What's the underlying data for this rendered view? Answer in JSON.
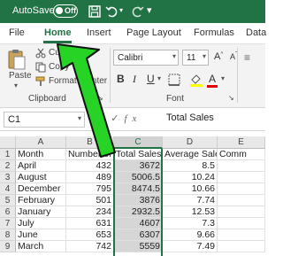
{
  "titlebar": {
    "autosave_label": "AutoSave",
    "autosave_state": "Off",
    "colors": {
      "bar": "#217346",
      "text": "#ffffff"
    },
    "icons": [
      "save-icon",
      "undo-icon",
      "redo-icon",
      "more-icon"
    ]
  },
  "tabs": [
    {
      "label": "File"
    },
    {
      "label": "Home",
      "active": true
    },
    {
      "label": "Insert"
    },
    {
      "label": "Page Layout"
    },
    {
      "label": "Formulas"
    },
    {
      "label": "Data"
    }
  ],
  "ribbon": {
    "paste_label": "Paste",
    "cut_label": "Cut",
    "copy_label": "Copy",
    "format_painter_label": "Format Painter",
    "clipboard_group": "Clipboard",
    "font_name": "Calibri",
    "font_size": "11",
    "font_group": "Font",
    "bold": "B",
    "italic": "I",
    "underline": "U",
    "font_color_letter": "A"
  },
  "formula_bar": {
    "name_box": "C1",
    "formula": "Total Sales",
    "icons": [
      "cancel-icon",
      "enter-icon",
      "fx-icon"
    ]
  },
  "sheet": {
    "columns": [
      "A",
      "B",
      "C",
      "D",
      "E"
    ],
    "rows": [
      {
        "n": "1",
        "cells": [
          "Month",
          "Number of Sales",
          "Total Sales",
          "Average Sale",
          "Comm"
        ]
      },
      {
        "n": "2",
        "cells": [
          "April",
          "432",
          "3672",
          "8.5",
          ""
        ]
      },
      {
        "n": "3",
        "cells": [
          "August",
          "489",
          "5006.5",
          "10.24",
          ""
        ]
      },
      {
        "n": "4",
        "cells": [
          "December",
          "795",
          "8474.5",
          "10.66",
          ""
        ]
      },
      {
        "n": "5",
        "cells": [
          "February",
          "501",
          "3876",
          "7.74",
          ""
        ]
      },
      {
        "n": "6",
        "cells": [
          "January",
          "234",
          "2932.5",
          "12.53",
          ""
        ]
      },
      {
        "n": "7",
        "cells": [
          "July",
          "631",
          "4607",
          "7.3",
          ""
        ]
      },
      {
        "n": "8",
        "cells": [
          "June",
          "653",
          "6307",
          "9.66",
          ""
        ]
      },
      {
        "n": "9",
        "cells": [
          "March",
          "742",
          "5559",
          "7.49",
          ""
        ]
      }
    ],
    "selected_column": "C",
    "accent": "#217346"
  },
  "annotation": {
    "arrow_color": "#27d325",
    "points_to": "Home"
  }
}
